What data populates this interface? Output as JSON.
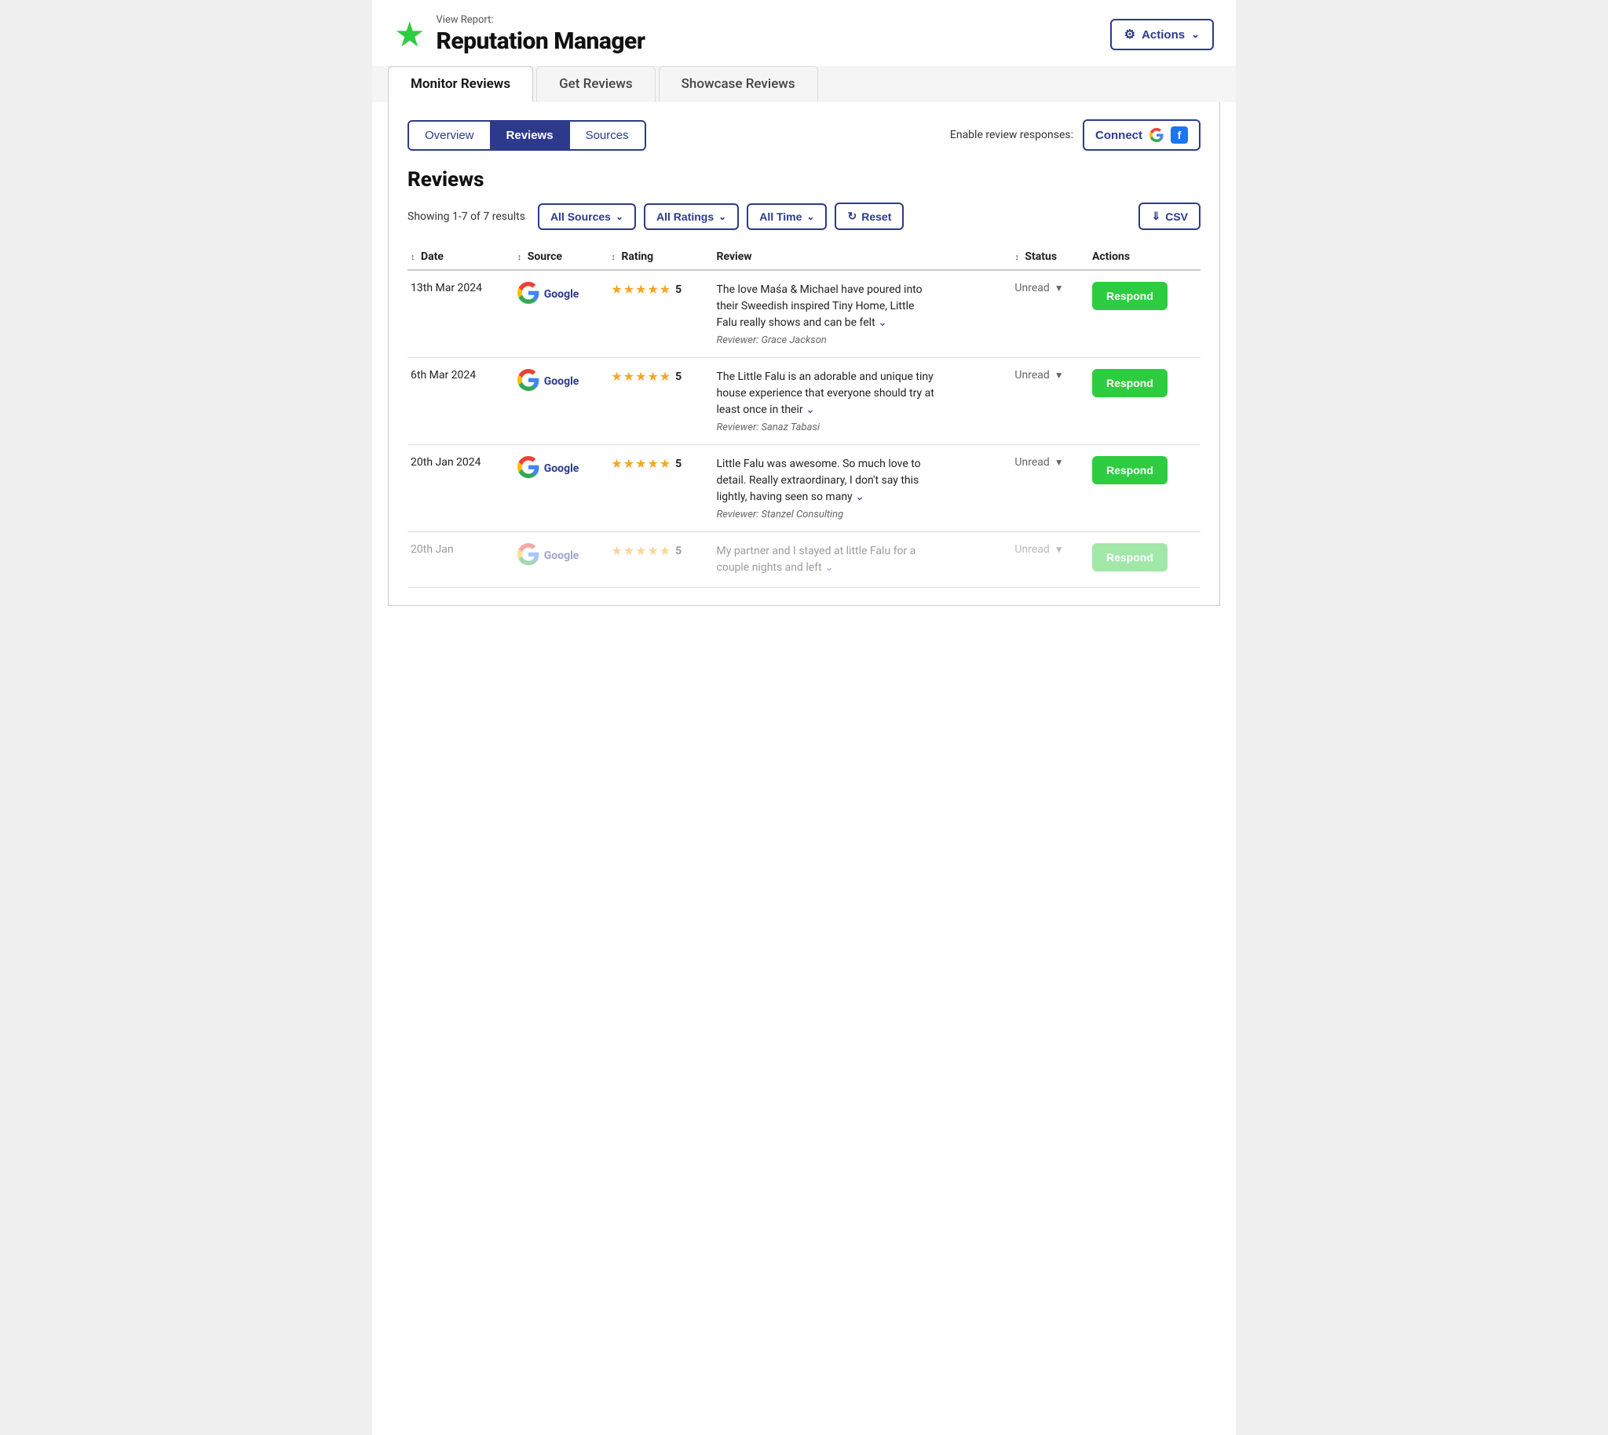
{
  "header": {
    "view_report_label": "View Report:",
    "app_title": "Reputation Manager",
    "actions_label": "Actions"
  },
  "main_tabs": [
    {
      "label": "Monitor Reviews",
      "active": true
    },
    {
      "label": "Get Reviews",
      "active": false
    },
    {
      "label": "Showcase Reviews",
      "active": false
    }
  ],
  "sub_tabs": [
    {
      "label": "Overview",
      "active": false
    },
    {
      "label": "Reviews",
      "active": true
    },
    {
      "label": "Sources",
      "active": false
    }
  ],
  "connect": {
    "label": "Enable review responses:",
    "button_label": "Connect"
  },
  "section": {
    "title": "Reviews",
    "showing_label": "Showing 1-7 of 7 results"
  },
  "filters": {
    "all_sources": "All Sources",
    "all_ratings": "All Ratings",
    "all_time": "All Time",
    "reset": "Reset",
    "csv": "CSV"
  },
  "table_headers": {
    "date": "Date",
    "source": "Source",
    "rating": "Rating",
    "review": "Review",
    "status": "Status",
    "actions": "Actions"
  },
  "reviews": [
    {
      "date": "13th Mar 2024",
      "source": "Google",
      "rating": 5,
      "review_text": "The love Maśa & Michael have poured into their Sweedish inspired Tiny Home, Little Falu really shows and can be felt",
      "reviewer": "Grace Jackson",
      "status": "Unread",
      "respond_label": "Respond",
      "faded": false
    },
    {
      "date": "6th Mar 2024",
      "source": "Google",
      "rating": 5,
      "review_text": "The Little Falu is an adorable and unique tiny house experience that everyone should try at least once in their",
      "reviewer": "Sanaz Tabasi",
      "status": "Unread",
      "respond_label": "Respond",
      "faded": false
    },
    {
      "date": "20th Jan 2024",
      "source": "Google",
      "rating": 5,
      "review_text": "Little Falu was awesome. So much love to detail. Really extraordinary, I don't say this lightly, having seen so many",
      "reviewer": "Stanzel Consulting",
      "status": "Unread",
      "respond_label": "Respond",
      "faded": false
    },
    {
      "date": "20th Jan",
      "source": "Google",
      "rating": 5,
      "review_text": "My partner and I stayed at little Falu for a couple nights and left",
      "reviewer": "",
      "status": "Unread",
      "respond_label": "Respond",
      "faded": true
    }
  ]
}
